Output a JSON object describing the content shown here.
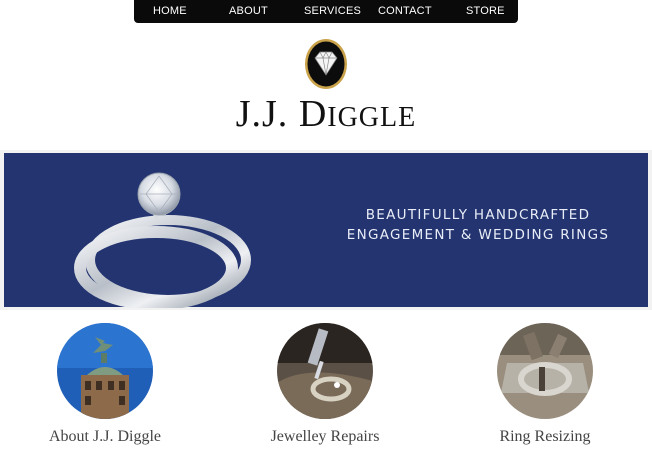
{
  "nav": {
    "items": [
      {
        "label": "HOME"
      },
      {
        "label": "ABOUT"
      },
      {
        "label": "SERVICES"
      },
      {
        "label": "CONTACT"
      },
      {
        "label": "STORE"
      }
    ]
  },
  "brand": {
    "initials": "J.J. ",
    "surname_initial": "D",
    "surname_rest": "IGGLE"
  },
  "hero": {
    "line1": "BEAUTIFULLY HANDCRAFTED",
    "line2": "ENGAGEMENT & WEDDING RINGS"
  },
  "features": [
    {
      "label": "About J.J. Diggle",
      "image": "liver-building-photo"
    },
    {
      "label": "Jewelley Repairs",
      "image": "jewellery-repair-photo"
    },
    {
      "label": "Ring Resizing",
      "image": "ring-resizing-photo"
    }
  ],
  "colors": {
    "nav_bg": "#0a0a0a",
    "hero_bg": "#233470",
    "label_text": "#444444"
  }
}
